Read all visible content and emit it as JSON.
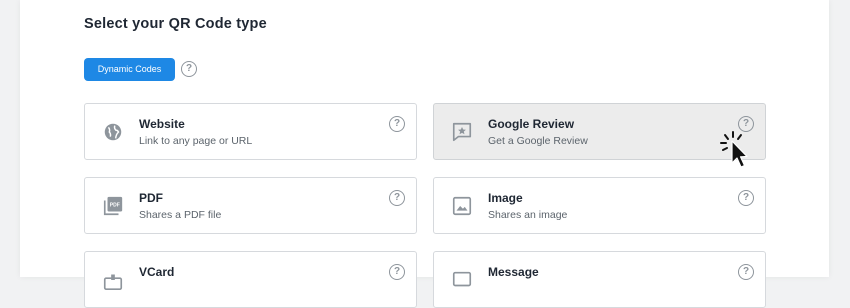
{
  "page": {
    "title": "Select your QR Code type"
  },
  "filter": {
    "chip_label": "Dynamic Codes",
    "help_glyph": "?"
  },
  "cards": [
    {
      "title": "Website",
      "subtitle": "Link to any page or URL",
      "icon": "globe-icon"
    },
    {
      "title": "Google Review",
      "subtitle": "Get a Google Review",
      "icon": "review-star-icon",
      "selected": true
    },
    {
      "title": "PDF",
      "subtitle": "Shares a PDF file",
      "icon": "pdf-icon"
    },
    {
      "title": "Image",
      "subtitle": "Shares an image",
      "icon": "image-icon"
    },
    {
      "title": "VCard",
      "subtitle": "",
      "icon": "vcard-icon"
    },
    {
      "title": "Message",
      "subtitle": "",
      "icon": "message-icon"
    }
  ],
  "colors": {
    "accent": "#1e88e5",
    "icon": "#8e959c",
    "selected_bg": "#ececec"
  }
}
